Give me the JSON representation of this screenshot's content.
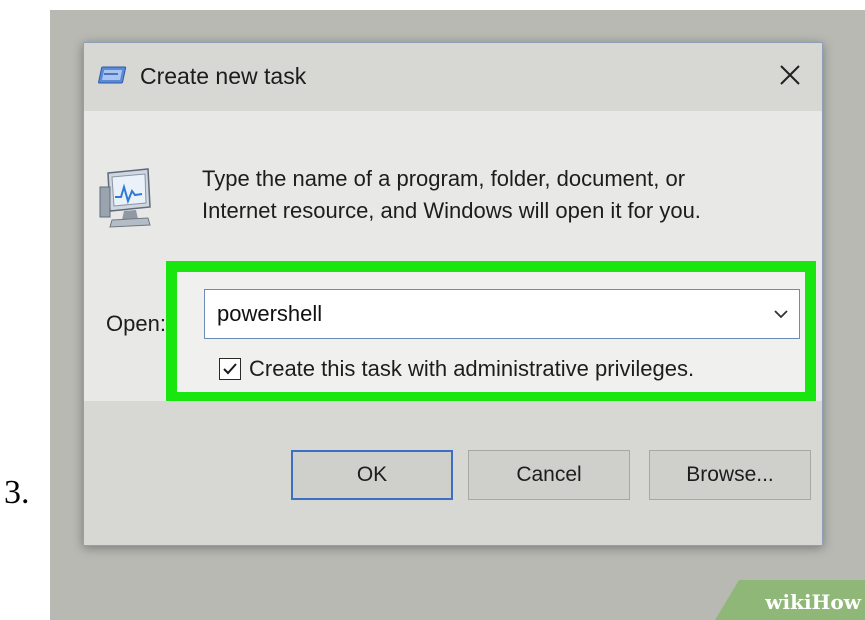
{
  "step": {
    "number": "3."
  },
  "dialog": {
    "title": "Create new task",
    "description_line1": "Type the name of a program, folder, document, or",
    "description_line2": "Internet resource, and Windows will open it for you.",
    "open_label": "Open:",
    "open_value": "powershell",
    "admin_checkbox_label": "Create this task with administrative privileges.",
    "admin_checked": true,
    "buttons": {
      "ok": "OK",
      "cancel": "Cancel",
      "browse": "Browse..."
    },
    "icons": {
      "title": "run-dialog-icon",
      "program": "computer-monitor-icon",
      "close": "close-icon",
      "dropdown": "chevron-down-icon",
      "check": "checkmark-icon"
    }
  },
  "highlight": {
    "color": "#19e60f"
  },
  "watermark": {
    "text": "wikiHow"
  }
}
